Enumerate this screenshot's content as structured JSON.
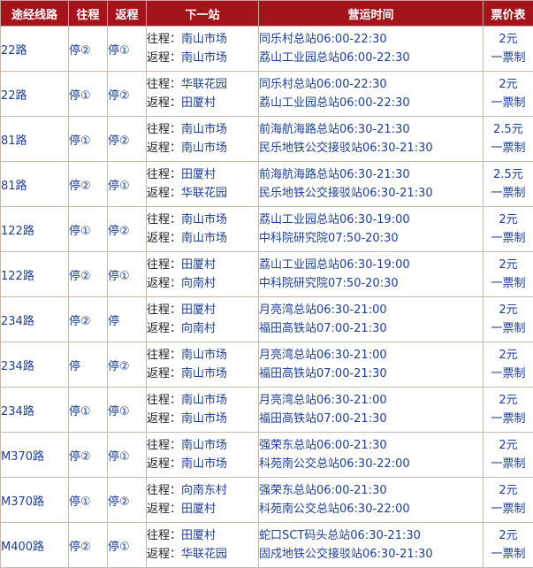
{
  "headers": [
    "途经线路",
    "往程",
    "返程",
    "下一站",
    "营运时间",
    "票价表"
  ],
  "labels": {
    "outbound": "往程：",
    "return": "返程："
  },
  "rows": [
    {
      "route": "22路",
      "out": "停②",
      "ret": "停①",
      "next_out": "南山市场",
      "next_ret": "南山市场",
      "hours1": "同乐村总站06:00-22:30",
      "hours2": "荔山工业园总站06:00-22:30",
      "price": "2元",
      "fare": "一票制"
    },
    {
      "route": "22路",
      "out": "停①",
      "ret": "停②",
      "next_out": "华联花园",
      "next_ret": "田厦村",
      "hours1": "同乐村总站06:00-22:30",
      "hours2": "荔山工业园总站06:00-22:30",
      "price": "2元",
      "fare": "一票制"
    },
    {
      "route": "81路",
      "out": "停①",
      "ret": "停②",
      "next_out": "南山市场",
      "next_ret": "南山市场",
      "hours1": "前海航海路总站06:30-21:30",
      "hours2": "民乐地铁公交接驳站06:30-21:30",
      "price": "2.5元",
      "fare": "一票制"
    },
    {
      "route": "81路",
      "out": "停②",
      "ret": "停①",
      "next_out": "田厦村",
      "next_ret": "华联花园",
      "hours1": "前海航海路总站06:30-21:30",
      "hours2": "民乐地铁公交接驳站06:30-21:30",
      "price": "2.5元",
      "fare": "一票制"
    },
    {
      "route": "122路",
      "out": "停①",
      "ret": "停②",
      "next_out": "南山市场",
      "next_ret": "南山市场",
      "hours1": "荔山工业园总站06:30-19:00",
      "hours2": "中科院研究院07:50-20:30",
      "price": "2元",
      "fare": "一票制"
    },
    {
      "route": "122路",
      "out": "停②",
      "ret": "停①",
      "next_out": "田厦村",
      "next_ret": "向南村",
      "hours1": "荔山工业园总站06:30-19:00",
      "hours2": "中科院研究院07:50-20:30",
      "price": "2元",
      "fare": "一票制"
    },
    {
      "route": "234路",
      "out": "停②",
      "ret": "停",
      "next_out": "田厦村",
      "next_ret": "向南村",
      "hours1": "月亮湾总站06:30-21:00",
      "hours2": "福田高铁站07:00-21:30",
      "price": "2元",
      "fare": "一票制"
    },
    {
      "route": "234路",
      "out": "停",
      "ret": "停②",
      "next_out": "南山市场",
      "next_ret": "南山市场",
      "hours1": "月亮湾总站06:30-21:00",
      "hours2": "福田高铁站07:00-21:30",
      "price": "2元",
      "fare": "一票制"
    },
    {
      "route": "234路",
      "out": "停①",
      "ret": "停①",
      "next_out": "南山市场",
      "next_ret": "南山市场",
      "hours1": "月亮湾总站06:30-21:00",
      "hours2": "福田高铁站07:00-21:30",
      "price": "2元",
      "fare": "一票制"
    },
    {
      "route": "M370路",
      "out": "停②",
      "ret": "停①",
      "next_out": "南山市场",
      "next_ret": "南山市场",
      "hours1": "强荣东总站06:00-21:30",
      "hours2": "科苑南公交总站06:30-22:00",
      "price": "2元",
      "fare": "一票制"
    },
    {
      "route": "M370路",
      "out": "停①",
      "ret": "停②",
      "next_out": "向南东村",
      "next_ret": "田厦村",
      "hours1": "强荣东总站06:00-21:30",
      "hours2": "科苑南公交总站06:30-22:00",
      "price": "2元",
      "fare": "一票制"
    },
    {
      "route": "M400路",
      "out": "停②",
      "ret": "停①",
      "next_out": "田厦村",
      "next_ret": "华联花园",
      "hours1": "蛇口SCT码头总站06:30-21:30",
      "hours2": "固戍地铁公交接驳站06:30-21:30",
      "price": "2元",
      "fare": "一票制"
    }
  ]
}
